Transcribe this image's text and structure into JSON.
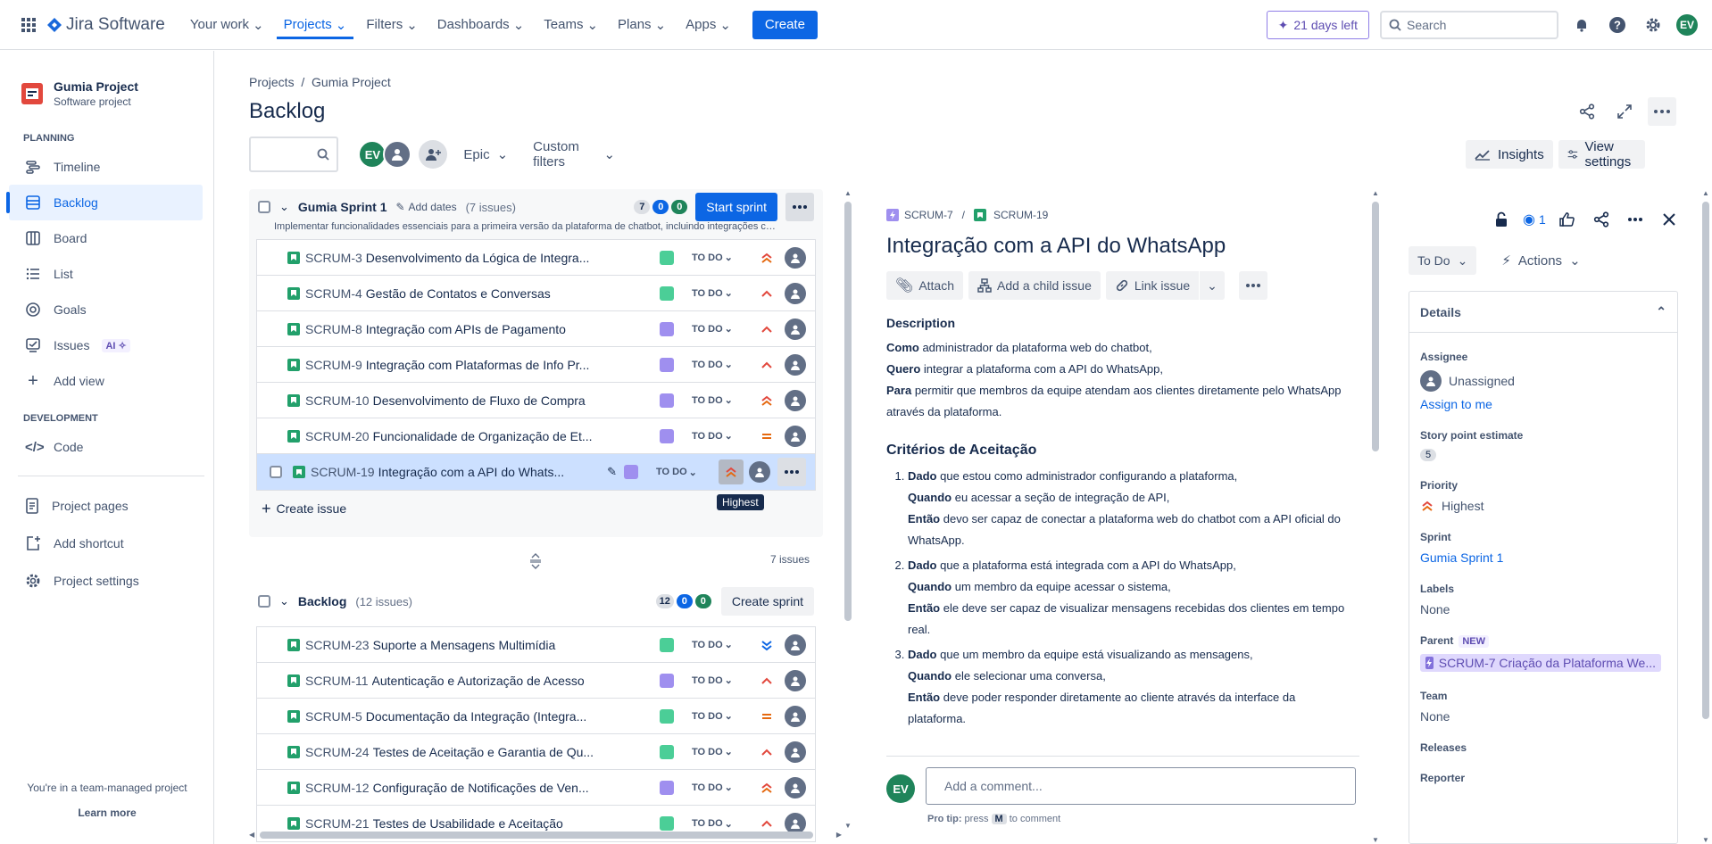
{
  "topbar": {
    "logo": "Jira Software",
    "nav": [
      {
        "label": "Your work"
      },
      {
        "label": "Projects"
      },
      {
        "label": "Filters"
      },
      {
        "label": "Dashboards"
      },
      {
        "label": "Teams"
      },
      {
        "label": "Plans"
      },
      {
        "label": "Apps"
      }
    ],
    "create": "Create",
    "trial": "21 days left",
    "search_placeholder": "Search",
    "avatar": "EV"
  },
  "sidebar": {
    "project_name": "Gumia Project",
    "project_type": "Software project",
    "planning_label": "PLANNING",
    "planning_items": [
      {
        "label": "Timeline"
      },
      {
        "label": "Backlog"
      },
      {
        "label": "Board"
      },
      {
        "label": "List"
      },
      {
        "label": "Goals"
      },
      {
        "label": "Issues"
      }
    ],
    "ai_badge": "AI",
    "add_view": "Add view",
    "development_label": "DEVELOPMENT",
    "code": "Code",
    "project_pages": "Project pages",
    "add_shortcut": "Add shortcut",
    "project_settings": "Project settings",
    "footer_text": "You're in a team-managed project",
    "learn_more": "Learn more"
  },
  "main": {
    "breadcrumb_projects": "Projects",
    "breadcrumb_sep": "/",
    "breadcrumb_project": "Gumia Project",
    "title": "Backlog",
    "epic_filter": "Epic",
    "custom_filters": "Custom filters",
    "insights": "Insights",
    "view_settings": "View settings",
    "avatar": "EV"
  },
  "sprint": {
    "name": "Gumia Sprint 1",
    "add_dates": "Add dates",
    "count": "(7 issues)",
    "pill_todo": "7",
    "pill_progress": "0",
    "pill_done": "0",
    "start": "Start sprint",
    "goal": "Implementar funcionalidades essenciais para a primeira versão da plataforma de chatbot, incluindo integrações com A...",
    "issues": [
      {
        "key": "SCRUM-3",
        "summary": "Desenvolvimento da Lógica de Integra...",
        "status": "TO DO",
        "epic_color": "#4bce97",
        "priority": "high"
      },
      {
        "key": "SCRUM-4",
        "summary": "Gestão de Contatos e Conversas",
        "status": "TO DO",
        "epic_color": "#4bce97",
        "priority": "medium-high"
      },
      {
        "key": "SCRUM-8",
        "summary": "Integração com APIs de Pagamento",
        "status": "TO DO",
        "epic_color": "#9f8fef",
        "priority": "medium-high"
      },
      {
        "key": "SCRUM-9",
        "summary": "Integração com Plataformas de Info Pr...",
        "status": "TO DO",
        "epic_color": "#9f8fef",
        "priority": "medium-high"
      },
      {
        "key": "SCRUM-10",
        "summary": "Desenvolvimento de Fluxo de Compra",
        "status": "TO DO",
        "epic_color": "#9f8fef",
        "priority": "high"
      },
      {
        "key": "SCRUM-20",
        "summary": "Funcionalidade de Organização de Et...",
        "status": "TO DO",
        "epic_color": "#9f8fef",
        "priority": "medium"
      },
      {
        "key": "SCRUM-19",
        "summary": "Integração com a API do Whats...",
        "status": "TO DO",
        "epic_color": "#9f8fef",
        "priority": "high"
      }
    ],
    "tooltip": "Highest",
    "create_issue": "Create issue",
    "issue_total": "7 issues"
  },
  "backlog": {
    "name": "Backlog",
    "count": "(12 issues)",
    "pill_todo": "12",
    "pill_progress": "0",
    "pill_done": "0",
    "create_sprint": "Create sprint",
    "issues": [
      {
        "key": "SCRUM-23",
        "summary": "Suporte a Mensagens Multimídia",
        "status": "TO DO",
        "epic_color": "#4bce97",
        "priority": "low"
      },
      {
        "key": "SCRUM-11",
        "summary": "Autenticação e Autorização de Acesso",
        "status": "TO DO",
        "epic_color": "#9f8fef",
        "priority": "medium-high"
      },
      {
        "key": "SCRUM-5",
        "summary": "Documentação da Integração (Integra...",
        "status": "TO DO",
        "epic_color": "#4bce97",
        "priority": "medium"
      },
      {
        "key": "SCRUM-24",
        "summary": "Testes de Aceitação e Garantia de Qu...",
        "status": "TO DO",
        "epic_color": "#4bce97",
        "priority": "medium-high"
      },
      {
        "key": "SCRUM-12",
        "summary": "Configuração de Notificações de Ven...",
        "status": "TO DO",
        "epic_color": "#9f8fef",
        "priority": "high"
      },
      {
        "key": "SCRUM-21",
        "summary": "Testes de Usabilidade e Aceitação",
        "status": "TO DO",
        "epic_color": "#4bce97",
        "priority": "medium-high"
      }
    ]
  },
  "detail": {
    "parent_key": "SCRUM-7",
    "sep": "/",
    "key": "SCRUM-19",
    "title": "Integração com a API do WhatsApp",
    "attach": "Attach",
    "add_child": "Add a child issue",
    "link_issue": "Link issue",
    "description_label": "Description",
    "desc_como_b": "Como",
    "desc_como": " administrador da plataforma web do chatbot,",
    "desc_quero_b": "Quero",
    "desc_quero": " integrar a plataforma com a API do WhatsApp,",
    "desc_para_b": "Para",
    "desc_para": " permitir que membros da equipe atendam aos clientes diretamente pelo WhatsApp através da plataforma.",
    "criteria_title": "Critérios de Aceitação",
    "criteria": [
      {
        "dado": "Dado",
        "dado_t": " que estou como administrador configurando a plataforma,",
        "quando": "Quando",
        "quando_t": " eu acessar a seção de integração de API,",
        "entao": "Então",
        "entao_t": " devo ser capaz de conectar a plataforma web do chatbot com a API oficial do WhatsApp."
      },
      {
        "dado": "Dado",
        "dado_t": " que a plataforma está integrada com a API do WhatsApp,",
        "quando": "Quando",
        "quando_t": " um membro da equipe acessar o sistema,",
        "entao": "Então",
        "entao_t": " ele deve ser capaz de visualizar mensagens recebidas dos clientes em tempo real."
      },
      {
        "dado": "Dado",
        "dado_t": " que um membro da equipe está visualizando as mensagens,",
        "quando": "Quando",
        "quando_t": " ele selecionar uma conversa,",
        "entao": "Então",
        "entao_t": " deve poder responder diretamente ao cliente através da interface da plataforma."
      }
    ],
    "comment_avatar": "EV",
    "comment_placeholder": "Add a comment...",
    "protip_a": "Pro tip:",
    "protip_b": " press ",
    "protip_key": "M",
    "protip_c": " to comment",
    "watch_count": "1",
    "status": "To Do",
    "actions": "Actions",
    "details_label": "Details",
    "assignee_label": "Assignee",
    "assignee": "Unassigned",
    "assign_to_me": "Assign to me",
    "story_points_label": "Story point estimate",
    "story_points": "5",
    "priority_label": "Priority",
    "priority": "Highest",
    "sprint_label": "Sprint",
    "sprint": "Gumia Sprint 1",
    "labels_label": "Labels",
    "labels": "None",
    "parent_label": "Parent",
    "parent_new": "NEW",
    "parent": "SCRUM-7 Criação da Plataforma We...",
    "team_label": "Team",
    "team": "None",
    "releases_label": "Releases",
    "reporter_label": "Reporter"
  },
  "colors": {
    "accent": "#0c66e4",
    "story": "#22a06b",
    "epic_purple": "#9f8fef",
    "epic_green": "#4bce97",
    "priority_high": "#e2483d",
    "priority_medium": "#e56910",
    "priority_low": "#0c66e4"
  }
}
